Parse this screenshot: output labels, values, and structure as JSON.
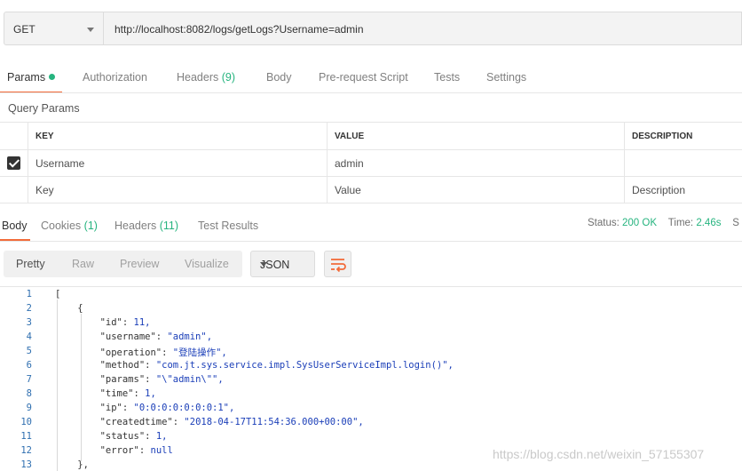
{
  "request": {
    "method": "GET",
    "url": "http://localhost:8082/logs/getLogs?Username=admin"
  },
  "request_tabs": [
    {
      "label": "Params",
      "active": true,
      "dot": true
    },
    {
      "label": "Authorization"
    },
    {
      "label": "Headers",
      "count": "(9)"
    },
    {
      "label": "Body"
    },
    {
      "label": "Pre-request Script"
    },
    {
      "label": "Tests"
    },
    {
      "label": "Settings"
    }
  ],
  "query_params": {
    "title": "Query Params",
    "headers": [
      "KEY",
      "VALUE",
      "DESCRIPTION"
    ],
    "rows": [
      {
        "checked": true,
        "key": "Username",
        "value": "admin",
        "description": ""
      }
    ],
    "placeholder": {
      "key": "Key",
      "value": "Value",
      "description": "Description"
    }
  },
  "response_tabs": [
    {
      "label": "Body",
      "active": true
    },
    {
      "label": "Cookies",
      "count": "(1)"
    },
    {
      "label": "Headers",
      "count": "(11)"
    },
    {
      "label": "Test Results"
    }
  ],
  "status": {
    "status_label": "Status:",
    "status_value": "200 OK",
    "time_label": "Time:",
    "time_value": "2.46s",
    "size_label": "S"
  },
  "view_modes": [
    "Pretty",
    "Raw",
    "Preview",
    "Visualize"
  ],
  "format": "JSON",
  "code_lines": [
    "[",
    "    {",
    "        \"id\": 11,",
    "        \"username\": \"admin\",",
    "        \"operation\": \"登陆操作\",",
    "        \"method\": \"com.jt.sys.service.impl.SysUserServiceImpl.login()\",",
    "        \"params\": \"\\\"admin\\\"\",",
    "        \"time\": 1,",
    "        \"ip\": \"0:0:0:0:0:0:0:1\",",
    "        \"createdtime\": \"2018-04-17T11:54:36.000+00:00\",",
    "        \"status\": 1,",
    "        \"error\": null",
    "    },"
  ],
  "watermark": "https://blog.csdn.net/weixin_57155307"
}
